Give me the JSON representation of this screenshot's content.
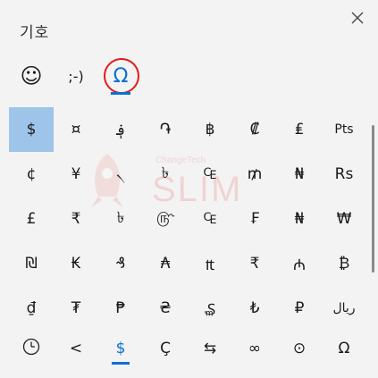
{
  "window": {
    "title": "기호",
    "close_icon": "close-icon"
  },
  "tabs": [
    {
      "label": "☺",
      "icon": "smiley-icon",
      "active": false
    },
    {
      "label": ";-)",
      "icon": "kaomoji-icon",
      "active": false
    },
    {
      "label": "Ω",
      "icon": "omega-symbol-icon",
      "active": true
    }
  ],
  "symbols": [
    [
      "$",
      "¤",
      "؋",
      "֏",
      "฿",
      "₡",
      "₤",
      "Pts"
    ],
    [
      "¢",
      "¥",
      "৲",
      "৳",
      "₠",
      "₥",
      "₦",
      "Rs"
    ],
    [
      "£",
      "₹",
      "৳",
      "௹",
      "₠",
      "₣",
      "₦",
      "₩"
    ],
    [
      "₪",
      "₭",
      "₰",
      "₳",
      "₶",
      "₹",
      "₼",
      "₿"
    ],
    [
      "₫",
      "₮",
      "₱",
      "₴",
      "₷",
      "₺",
      "₽",
      "ريال"
    ]
  ],
  "selected_symbol": "$",
  "recent_bar": [
    {
      "label": "🕒",
      "icon": "recent-clock-icon",
      "active": false
    },
    {
      "label": "<",
      "icon": "",
      "active": false
    },
    {
      "label": "$",
      "icon": "",
      "active": true
    },
    {
      "label": "Ç",
      "icon": "",
      "active": false
    },
    {
      "label": "⇆",
      "icon": "",
      "active": false
    },
    {
      "label": "∞",
      "icon": "",
      "active": false
    },
    {
      "label": "⊙",
      "icon": "",
      "active": false
    },
    {
      "label": "Ω",
      "icon": "",
      "active": false
    }
  ],
  "watermark": {
    "text": "SLIM",
    "small": "ChangeTech"
  },
  "colors": {
    "accent": "#0a6fd6",
    "selected_bg": "#9ec4ea",
    "highlight_ring": "#e01b1b"
  }
}
